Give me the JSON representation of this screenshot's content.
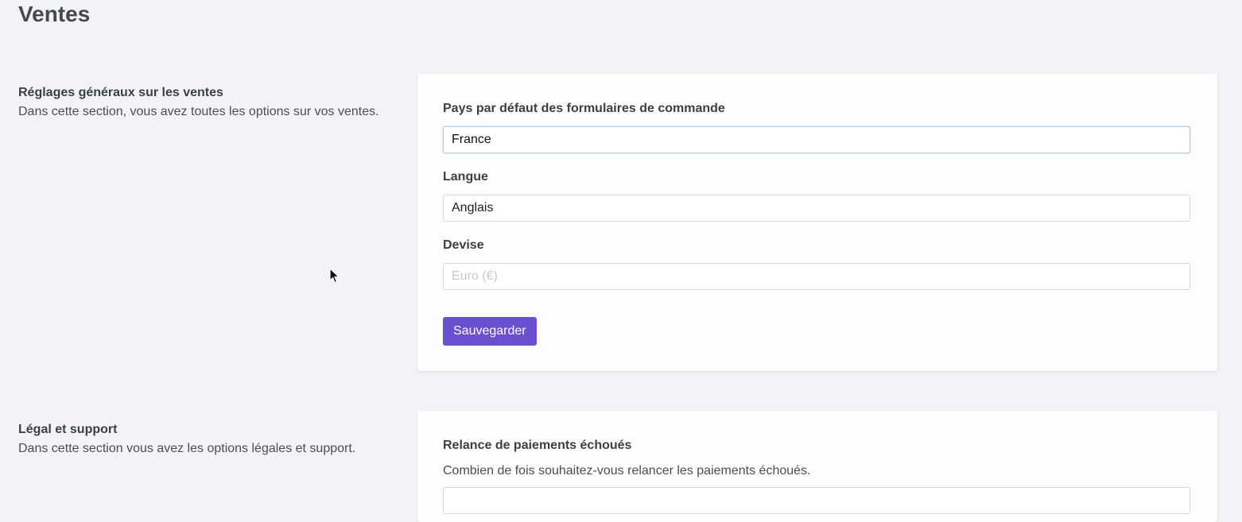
{
  "page": {
    "title": "Ventes"
  },
  "sales_settings": {
    "heading": "Réglages généraux sur les ventes",
    "description": "Dans cette section, vous avez toutes les options sur vos ventes.",
    "country_label": "Pays par défaut des formulaires de commande",
    "country_value": "France",
    "language_label": "Langue",
    "language_value": "Anglais",
    "currency_label": "Devise",
    "currency_placeholder": "Euro (€)",
    "save_label": "Sauvegarder"
  },
  "legal_support": {
    "heading": "Légal et support",
    "description": "Dans cette section vous avez les options légales et support.",
    "dunning_label": "Relance de paiements échoués",
    "dunning_help": "Combien de fois souhaitez-vous relancer les paiements échoués."
  },
  "colors": {
    "accent": "#6a4fd0",
    "background": "#f2f3f7",
    "card": "#fdfdfd"
  }
}
